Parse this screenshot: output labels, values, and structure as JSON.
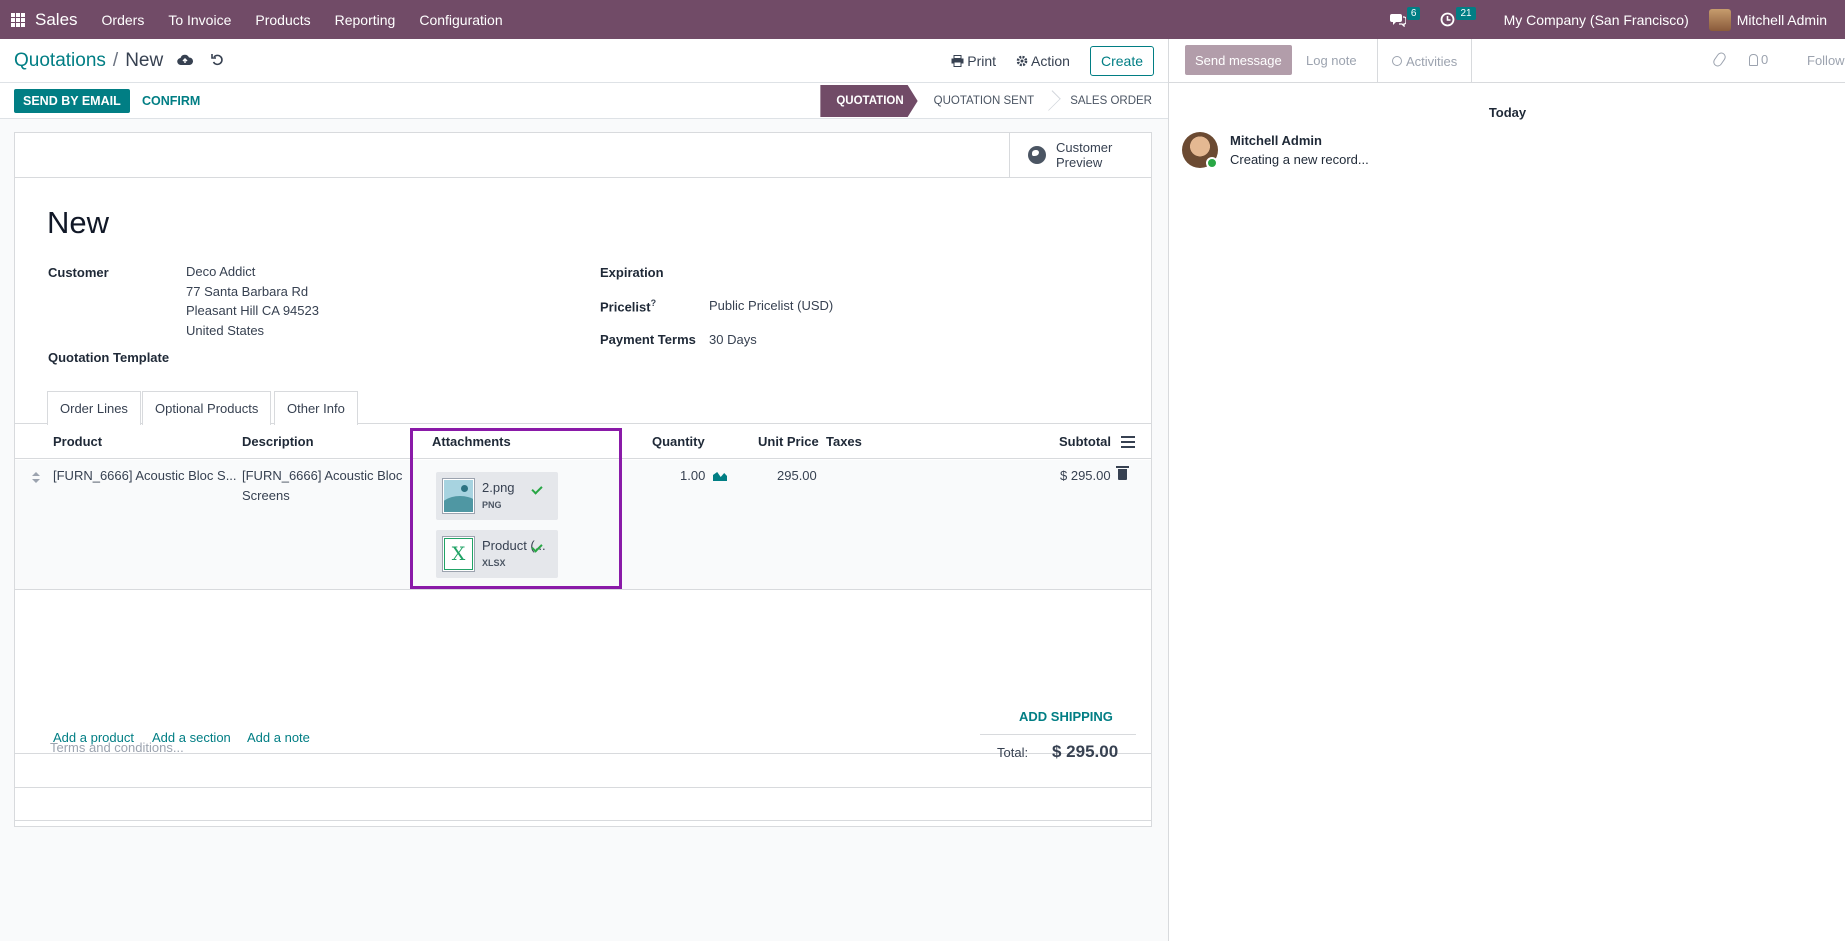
{
  "nav": {
    "brand": "Sales",
    "items": [
      "Orders",
      "To Invoice",
      "Products",
      "Reporting",
      "Configuration"
    ],
    "messages_count": "6",
    "activities_count": "21",
    "company": "My Company (San Francisco)",
    "user": "Mitchell Admin"
  },
  "control": {
    "breadcrumb_parent": "Quotations",
    "breadcrumb_sep": "/",
    "breadcrumb_current": "New",
    "print_label": "Print",
    "action_label": "Action",
    "create_label": "Create"
  },
  "statusbar": {
    "send_email_label": "SEND BY EMAIL",
    "confirm_label": "CONFIRM",
    "stages": [
      "QUOTATION",
      "QUOTATION SENT",
      "SALES ORDER"
    ],
    "active_stage": "QUOTATION"
  },
  "form": {
    "smart_button": {
      "line1": "Customer",
      "line2": "Preview"
    },
    "title": "New",
    "customer_label": "Customer",
    "customer_name": "Deco Addict",
    "customer_address": [
      "77 Santa Barbara Rd",
      "Pleasant Hill CA 94523",
      "United States"
    ],
    "template_label": "Quotation Template",
    "expiration_label": "Expiration",
    "pricelist_label": "Pricelist",
    "pricelist_help": "?",
    "pricelist_value": "Public Pricelist (USD)",
    "payment_terms_label": "Payment Terms",
    "payment_terms_value": "30 Days"
  },
  "tabs": [
    "Order Lines",
    "Optional Products",
    "Other Info"
  ],
  "table": {
    "columns": [
      "Product",
      "Description",
      "Attachments",
      "Quantity",
      "Unit Price",
      "Taxes",
      "Subtotal"
    ],
    "row": {
      "product": "[FURN_6666] Acoustic Bloc S...",
      "description_line1": "[FURN_6666] Acoustic Bloc",
      "description_line2": "Screens",
      "attachments": [
        {
          "name": "2.png",
          "ext": "PNG"
        },
        {
          "name": "Product (...",
          "ext": "XLSX"
        }
      ],
      "quantity": "1.00",
      "unit_price": "295.00",
      "subtotal": "$ 295.00"
    },
    "add_product": "Add a product",
    "add_section": "Add a section",
    "add_note": "Add a note"
  },
  "footer": {
    "terms_placeholder": "Terms and conditions...",
    "add_shipping": "ADD SHIPPING",
    "total_label": "Total:",
    "total_value": "$ 295.00"
  },
  "chatter": {
    "send_message": "Send message",
    "log_note": "Log note",
    "activities": "Activities",
    "followers_count": "0",
    "follow": "Follow",
    "date_separator": "Today",
    "message_author": "Mitchell Admin",
    "message_body": "Creating a new record..."
  },
  "colors": {
    "brand": "#714b67",
    "accent": "#017e84",
    "highlight": "#8a1aa8"
  }
}
